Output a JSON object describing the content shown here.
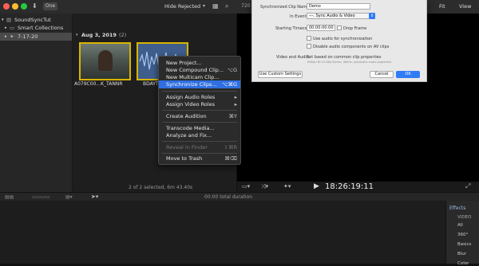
{
  "toolbar": {
    "traffic_colors": [
      "#ff5f57",
      "#febc2e",
      "#28c840"
    ],
    "badge_label": "One",
    "hide_rejected_label": "Hide Rejected",
    "zoom_value": "720",
    "fit_label": "Fit",
    "view_label": "View"
  },
  "sidebar": {
    "library_name": "SoundSyncTut",
    "smart_collections": "Smart Collections",
    "event_name": "7-17-20"
  },
  "browser": {
    "date_header": "Aug 3, 2019",
    "date_count": "(2)",
    "clips": [
      {
        "label": "A079C00...K_TANNR"
      },
      {
        "label": "BDAYTOR"
      }
    ],
    "status": "2 of 2 selected, 6m 43.40s"
  },
  "context_menu": {
    "items": [
      {
        "label": "New Project...",
        "shortcut": "",
        "enabled": true
      },
      {
        "label": "New Compound Clip...",
        "shortcut": "⌥G",
        "enabled": true
      },
      {
        "label": "New Multicam Clip...",
        "shortcut": "",
        "enabled": true
      },
      {
        "label": "Synchronize Clips...",
        "shortcut": "⌥⌘G",
        "enabled": true,
        "highlighted": true
      },
      {
        "label": "Assign Audio Roles",
        "shortcut": "▸",
        "enabled": true
      },
      {
        "label": "Assign Video Roles",
        "shortcut": "▸",
        "enabled": true
      },
      {
        "label": "Create Audition",
        "shortcut": "⌘Y",
        "enabled": true
      },
      {
        "label": "Transcode Media...",
        "shortcut": "",
        "enabled": true
      },
      {
        "label": "Analyze and Fix...",
        "shortcut": "",
        "enabled": true
      },
      {
        "label": "Reveal in Finder",
        "shortcut": "⇧⌘R",
        "enabled": false
      },
      {
        "label": "Move to Trash",
        "shortcut": "⌘⌫",
        "enabled": true
      }
    ],
    "highlight_color": "#2f6fe0"
  },
  "dialog": {
    "clip_name_label": "Synchronized Clip Name:",
    "clip_name_value": "Demo",
    "in_event_label": "In Event:",
    "in_event_value": "---. Sync Audio & Video",
    "timecode_label": "Starting Timecode:",
    "timecode_value": "00:00:00:00",
    "drop_frame_label": "Drop Frame",
    "use_audio_label": "Use audio for synchronization",
    "disable_audio_label": "Disable audio components on AV clips",
    "video_audio_label": "Video and Audio:",
    "video_audio_value": "Set based on common clip properties",
    "video_audio_detail": "1080p HD 23.98p Stereo, 48kHz, automatic audio properties",
    "custom_settings_label": "Use Custom Settings",
    "cancel_label": "Cancel",
    "ok_label": "OK",
    "ok_color": "#2f7cf6"
  },
  "viewer": {
    "timecode": "18:26:19:11"
  },
  "timeline": {
    "duration": "00:00 total duration"
  },
  "effects": {
    "header": "Effects",
    "items": [
      "VIDEO",
      "All",
      "360°",
      "Basics",
      "Blur",
      "Color"
    ]
  }
}
